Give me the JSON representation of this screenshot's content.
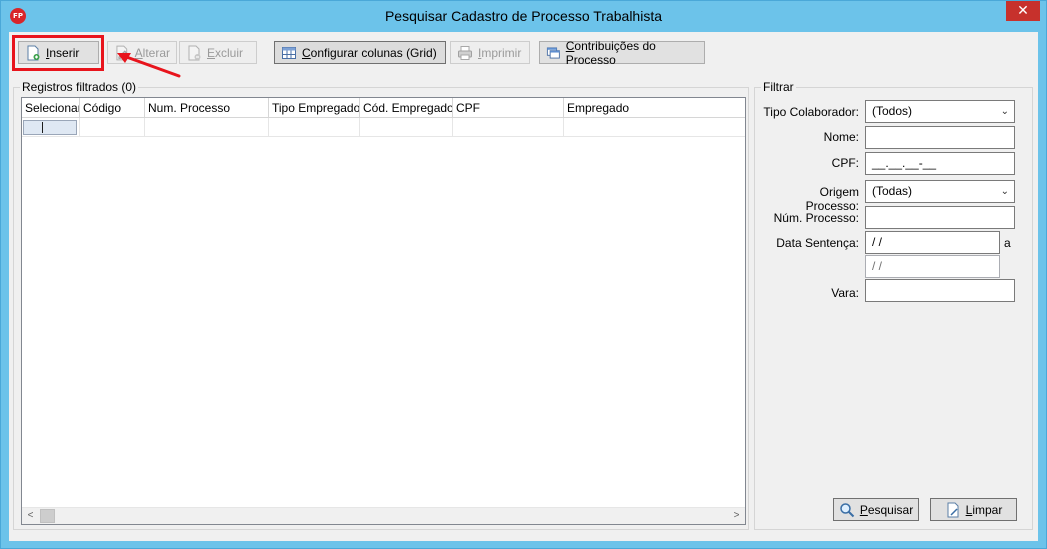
{
  "window": {
    "title": "Pesquisar Cadastro de Processo Trabalhista",
    "app_icon_text": "FP",
    "close_glyph": "✕"
  },
  "toolbar": {
    "inserir": "Inserir",
    "alterar": "Alterar",
    "excluir": "Excluir",
    "configurar": "Configurar colunas (Grid)",
    "imprimir": "Imprimir",
    "contribuicoes": "Contribuições do Processo"
  },
  "grid": {
    "group_label": "Registros filtrados (0)",
    "columns": [
      "Selecionar",
      "Código",
      "Num. Processo",
      "Tipo Empregado",
      "Cód. Empregado",
      "CPF",
      "Empregado"
    ]
  },
  "filter": {
    "group_label": "Filtrar",
    "tipo_colaborador_label": "Tipo Colaborador:",
    "tipo_colaborador_value": "(Todos)",
    "nome_label": "Nome:",
    "nome_value": "",
    "cpf_label": "CPF:",
    "cpf_mask": "__.__.__-__",
    "origem_label": "Origem Processo:",
    "origem_value": "(Todas)",
    "num_processo_label": "Núm. Processo:",
    "num_processo_value": "",
    "data_sentenca_label": "Data Sentença:",
    "data_de": " / /",
    "data_ate": " / /",
    "data_sep": "a",
    "vara_label": "Vara:",
    "vara_value": ""
  },
  "buttons": {
    "pesquisar": "Pesquisar",
    "limpar": "Limpar"
  },
  "colors": {
    "frame": "#6cc3ea",
    "highlight": "#e8141c",
    "close": "#c7312c"
  }
}
